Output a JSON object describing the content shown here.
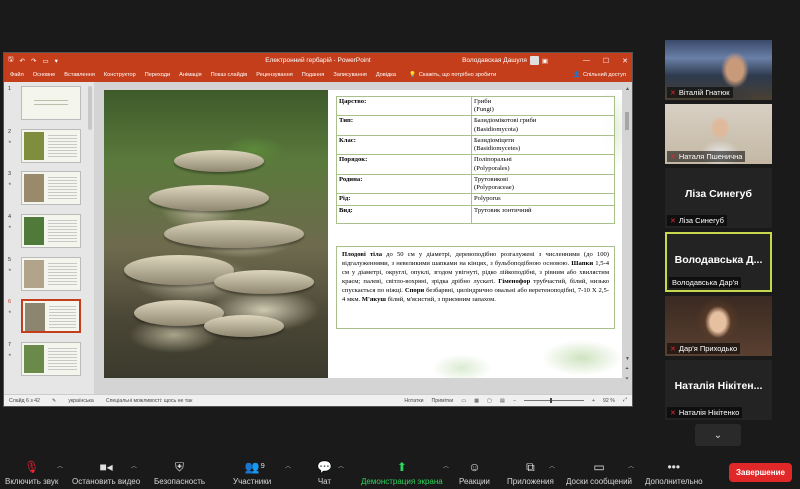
{
  "ppt": {
    "title": "Електронний гербарій - PowerPoint",
    "user": "Володавская Дашуля",
    "ribbon_tabs": [
      "Файл",
      "Основне",
      "Вставлення",
      "Конструктор",
      "Переходи",
      "Анімація",
      "Показ слайдів",
      "Рецензування",
      "Подання",
      "Записування",
      "Довідка"
    ],
    "tell_me": "Скажіть, що потрібно зробити",
    "share": "Спільний доступ",
    "thumbnails": [
      "1",
      "2",
      "3",
      "4",
      "5",
      "6",
      "7"
    ],
    "active_slide": 6,
    "table": [
      {
        "key": "Царство:",
        "value": "Гриби",
        "latin": "(Fungi)"
      },
      {
        "key": "Тип:",
        "value": "Базидіомікотові гриби",
        "latin": "(Basidiomycota)"
      },
      {
        "key": "Клас:",
        "value": "Базидіоміцети",
        "latin": "(Basidiomycetes)"
      },
      {
        "key": "Порядок:",
        "value": "Поліпоральні",
        "latin": "(Polyporales)"
      },
      {
        "key": "Родина:",
        "value": "Трутовикові",
        "latin": "(Polyporaceae)"
      },
      {
        "key": "Рід:",
        "value": "Polyporus",
        "latin": ""
      },
      {
        "key": "Вид:",
        "value": "Трутовик зонтичний",
        "latin": ""
      }
    ],
    "description": {
      "b1": "Плодові тіла",
      "t1": " до 50 см у діаметрі, деревоподібно розгалужені з численними (до 100) відгалуженнями, з невеликими шапками на кінцях, з бульбоподібною основою. ",
      "b2": "Шапки",
      "t2": " 1,5-4 см у діаметрі, округлі, опуклі, згодом увігнуті, рідко лійкоподібні, з рівним або хвилястим краєм; палеві, світло-вохряні, зрідка дрібно лускаті. ",
      "b3": "Гіменофор",
      "t3": " трубчастий, білий, низько спускається по ніжці. ",
      "b4": "Спори",
      "t4": " безбарвні, циліндрично овальні або веретеноподібні, 7-10 X 2,5-4 мкм. ",
      "b5": "М'якуш",
      "t5": " білий, м'ясистий, з приємним запахом."
    },
    "status": {
      "slide": "Слайд 6 з 42",
      "language": "українська",
      "accessibility": "Спеціальні можливості: щось не так",
      "notes": "Нотатки",
      "comments": "Примітки",
      "zoom": "92 %"
    },
    "colors": {
      "accent": "#c43e1c"
    }
  },
  "participants": [
    {
      "name": "Віталій Гнатюк",
      "type": "video"
    },
    {
      "name": "Наталя Пшенична",
      "type": "video"
    },
    {
      "name": "Ліза Синегуб",
      "big": "Ліза Синегуб",
      "type": "name"
    },
    {
      "name": "Володавська Дар'я",
      "big": "Володавська Д...",
      "type": "name",
      "active": true
    },
    {
      "name": "Дар'я Приходько",
      "type": "video"
    },
    {
      "name": "Наталія Нікітенко",
      "big": "Наталія Нікітен...",
      "type": "name"
    }
  ],
  "toolbar": {
    "mute": "Включить звук",
    "video": "Остановить видео",
    "security": "Безопасность",
    "participants": "Участники",
    "participants_count": "9",
    "chat": "Чат",
    "share": "Демонстрация экрана",
    "reactions": "Реакции",
    "apps": "Приложения",
    "whiteboards": "Доски сообщений",
    "more": "Дополнительно",
    "end": "Завершение"
  }
}
